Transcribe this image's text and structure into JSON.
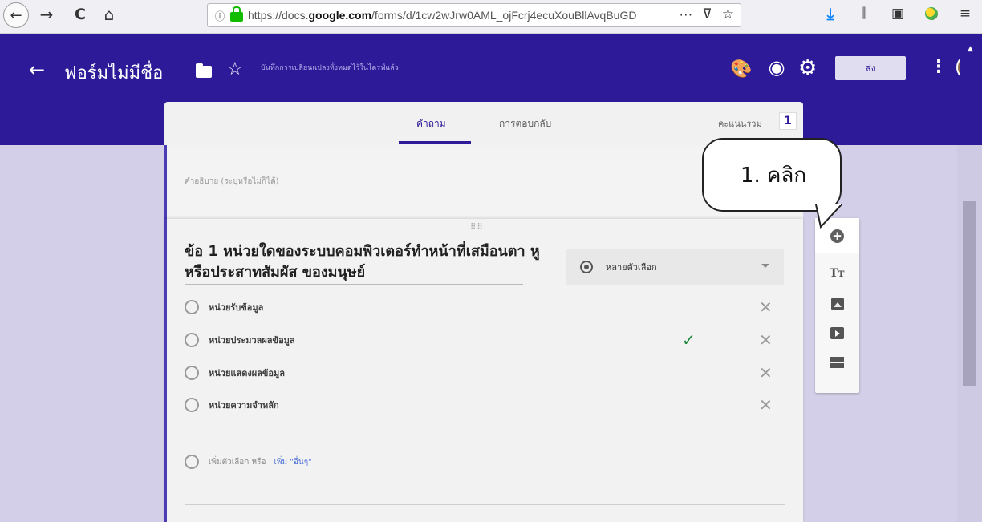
{
  "browser": {
    "url_prefix": "https://docs.",
    "url_domain": "google.com",
    "url_path": "/forms/d/1cw2wJrw0AML_ojFcrj4ecuXouBllAvqBuGD",
    "more_label": "···",
    "pocket_icon": "pocket-icon",
    "bookmark_icon": "star-icon"
  },
  "header": {
    "title": "ฟอร์มไม่มีชื่อ",
    "saved_status": "บันทึกการเปลี่ยนแปลงทั้งหมดไว้ในไดรฟ์แล้ว",
    "send_label": "ส่ง",
    "colors": {
      "primary": "#2c1a99"
    }
  },
  "tabs": {
    "questions": "คำถาม",
    "responses": "การตอบกลับ",
    "total_score_label": "คะแนนรวม",
    "total_score": "1"
  },
  "description": {
    "placeholder": "คำอธิบาย (ระบุหรือไม่ก็ได้)"
  },
  "question": {
    "title": "ข้อ 1 หน่วยใดของระบบคอมพิวเตอร์ทำหน้าที่เสมือนตา หู หรือประสาทสัมผัส ของมนุษย์",
    "type": "หลายตัวเลือก",
    "options": [
      {
        "label": "หน่วยรับข้อมูล",
        "correct": false
      },
      {
        "label": "หน่วยประมวลผลข้อมูล",
        "correct": true
      },
      {
        "label": "หน่วยแสดงผลข้อมูล",
        "correct": false
      },
      {
        "label": "หน่วยความจำหลัก",
        "correct": false
      }
    ],
    "add_option_label": "เพิ่มตัวเลือก หรือ",
    "add_other_label": "เพิ่ม \"อื่นๆ\""
  },
  "callout": {
    "text": "1. คลิก"
  }
}
